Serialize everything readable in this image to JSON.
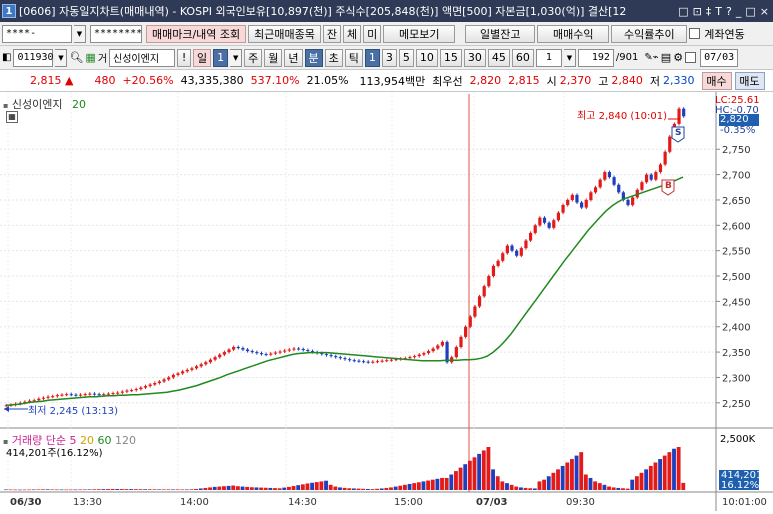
{
  "titlebar": {
    "window_number": "1",
    "title": "[0606] 자동일지차트(매매내역) - KOSPI 외국인보유[10,897(천)] 주식수[205,848(천)] 액면[500] 자본금[1,030(억)] 결산[12",
    "controls": [
      "□",
      "⊡",
      "‡",
      "T",
      "?",
      "_",
      "□",
      "×"
    ]
  },
  "toolbar1": {
    "account_masked": "****-",
    "password_masked": "********",
    "buttons": [
      "매매마크/내역 조회",
      "최근매매종목",
      "잔",
      "체",
      "미",
      "메모보기",
      "일별잔고",
      "매매수익",
      "수익률추이"
    ],
    "link_checkbox_label": "계좌연동"
  },
  "toolbar2": {
    "stock_code": "011930",
    "stock_name": "신성이엔지",
    "period_buttons": [
      "!",
      "일",
      "주",
      "월",
      "년",
      "분",
      "초",
      "틱"
    ],
    "minute_buttons": [
      "1",
      "3",
      "5",
      "10",
      "15",
      "30",
      "45",
      "60"
    ],
    "interval_value": "1",
    "count_value": "192",
    "count_total": "/901",
    "date_value": "07/03"
  },
  "quote": {
    "price": "2,815",
    "change": "480",
    "change_pct": "+20.56%",
    "volume": "43,335,380",
    "vol_ratio": "537.10%",
    "turnover": "21.05%",
    "amount": "113,954백만",
    "best_ask_label": "최우선",
    "best_ask1": "2,820",
    "best_ask2": "2,815",
    "open_label": "시",
    "open": "2,370",
    "high_label": "고",
    "high": "2,840",
    "low_label": "저",
    "low": "2,330",
    "buy_button": "매수",
    "sell_button": "매도"
  },
  "chart_data": {
    "type": "candlestick",
    "legend_price": "신성이엔지",
    "legend_ma_value": "20",
    "y_ticks": [
      2250,
      2300,
      2350,
      2400,
      2450,
      2500,
      2550,
      2600,
      2650,
      2700,
      2750
    ],
    "ylim": [
      2222,
      2855
    ],
    "right_labels": {
      "lc": "LC:25.61",
      "hc": "HC:-0.70",
      "current": "2,820",
      "change": "-0.35%"
    },
    "x_labels": [
      "06/30",
      "13:30",
      "14:00",
      "14:30",
      "15:00",
      "07/03",
      "09:30",
      "10:01:00"
    ],
    "high_annotation": "최고 2,840 (10:01)",
    "low_annotation": "최저 2,245 (13:13)",
    "trade_marks": [
      {
        "label": "S"
      },
      {
        "label": "B"
      }
    ],
    "closes": [
      2245,
      2246,
      2248,
      2250,
      2252,
      2254,
      2255,
      2258,
      2260,
      2262,
      2263,
      2265,
      2266,
      2267,
      2266,
      2265,
      2266,
      2267,
      2268,
      2267,
      2266,
      2267,
      2268,
      2269,
      2270,
      2272,
      2274,
      2275,
      2277,
      2280,
      2283,
      2286,
      2289,
      2292,
      2296,
      2300,
      2305,
      2308,
      2312,
      2315,
      2318,
      2322,
      2326,
      2330,
      2335,
      2340,
      2345,
      2350,
      2355,
      2360,
      2358,
      2355,
      2352,
      2350,
      2348,
      2346,
      2345,
      2347,
      2349,
      2351,
      2353,
      2355,
      2357,
      2356,
      2354,
      2352,
      2350,
      2348,
      2346,
      2344,
      2342,
      2340,
      2338,
      2336,
      2334,
      2333,
      2332,
      2331,
      2330,
      2331,
      2332,
      2333,
      2334,
      2335,
      2336,
      2337,
      2338,
      2340,
      2342,
      2345,
      2348,
      2352,
      2357,
      2363,
      2370,
      2330,
      2340,
      2360,
      2380,
      2400,
      2420,
      2440,
      2460,
      2480,
      2500,
      2520,
      2530,
      2545,
      2560,
      2550,
      2540,
      2555,
      2570,
      2585,
      2600,
      2615,
      2605,
      2595,
      2610,
      2625,
      2640,
      2650,
      2660,
      2645,
      2635,
      2650,
      2665,
      2675,
      2690,
      2705,
      2695,
      2680,
      2665,
      2650,
      2640,
      2655,
      2670,
      2685,
      2700,
      2690,
      2705,
      2720,
      2745,
      2775,
      2800,
      2830,
      2815
    ],
    "ma20": [
      2245,
      2246,
      2247,
      2249,
      2251,
      2252,
      2253,
      2255,
      2256,
      2257,
      2258,
      2259,
      2260,
      2261,
      2262,
      2262,
      2263,
      2264,
      2264,
      2265,
      2265,
      2266,
      2266,
      2267,
      2268,
      2269,
      2270,
      2271,
      2273,
      2275,
      2278,
      2281,
      2284,
      2288,
      2292,
      2296,
      2300,
      2305,
      2309,
      2313,
      2317,
      2321,
      2325,
      2329,
      2333,
      2336,
      2339,
      2342,
      2345,
      2347,
      2348,
      2349,
      2349,
      2349,
      2349,
      2348,
      2347,
      2346,
      2345,
      2344,
      2343,
      2342,
      2341,
      2340,
      2339,
      2338,
      2337,
      2336,
      2335,
      2334,
      2333,
      2333,
      2333,
      2333,
      2334,
      2334,
      2334,
      2335,
      2335,
      2336,
      2338,
      2342,
      2350,
      2360,
      2372,
      2386,
      2402,
      2418,
      2434,
      2450,
      2466,
      2482,
      2498,
      2514,
      2530,
      2545,
      2560,
      2575,
      2590,
      2603,
      2616,
      2628,
      2638,
      2646,
      2652,
      2656,
      2660,
      2664,
      2668,
      2672,
      2676,
      2680,
      2685,
      2690,
      2695
    ],
    "volume_legend": {
      "title": "거래량",
      "ma_label": "단순",
      "ma_periods": [
        "5",
        "20",
        "60",
        "120"
      ],
      "current": "414,201주(16.12%)"
    },
    "volume_ticks": [
      "2,500K"
    ],
    "volume_current_label": "414,201",
    "volume_current_pct": "16.12%",
    "volumes": [
      30,
      28,
      25,
      22,
      24,
      26,
      30,
      35,
      40,
      38,
      33,
      30,
      28,
      26,
      25,
      27,
      30,
      32,
      35,
      40,
      45,
      50,
      55,
      60,
      58,
      55,
      52,
      50,
      48,
      45,
      42,
      40,
      38,
      36,
      35,
      34,
      33,
      32,
      31,
      30,
      40,
      60,
      90,
      120,
      150,
      180,
      200,
      220,
      240,
      260,
      220,
      200,
      180,
      160,
      150,
      140,
      130,
      120,
      110,
      100,
      140,
      180,
      230,
      280,
      330,
      380,
      420,
      460,
      500,
      540,
      300,
      200,
      150,
      120,
      100,
      90,
      80,
      70,
      60,
      50,
      70,
      90,
      120,
      150,
      200,
      250,
      300,
      350,
      400,
      450,
      500,
      550,
      600,
      650,
      700,
      700,
      900,
      1100,
      1300,
      1500,
      1700,
      1900,
      2100,
      2300,
      2500,
      1200,
      800,
      500,
      400,
      300,
      200,
      150,
      120,
      100,
      90,
      500,
      600,
      800,
      1000,
      1200,
      1400,
      1600,
      1800,
      2000,
      2200,
      900,
      700,
      500,
      400,
      300,
      200,
      150,
      120,
      100,
      80,
      600,
      800,
      1000,
      1200,
      1400,
      1600,
      1800,
      2000,
      2200,
      2400,
      2500,
      414
    ]
  }
}
